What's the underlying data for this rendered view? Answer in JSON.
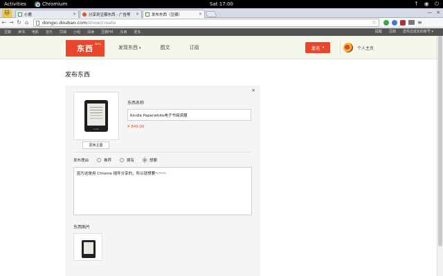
{
  "system": {
    "activities": "Activities",
    "app_name": "Chromium",
    "clock": "Sat 17:00",
    "tray": [
      "↑",
      "◉",
      "⏻"
    ]
  },
  "browser": {
    "profile_icon": "🐱",
    "tabs": [
      {
        "title": "小鹿",
        "favicon": "douban",
        "active": false
      },
      {
        "title": "分享到豆瓣东西 - 广告等",
        "favicon": "share",
        "active": false
      },
      {
        "title": "发布东西（豆瓣）",
        "favicon": "douban",
        "active": true
      }
    ],
    "tab_close": "×",
    "window_controls": [
      "—",
      "×"
    ],
    "nav": {
      "back": "←",
      "forward": "→",
      "reload": "↻",
      "home": "⌂"
    },
    "url_host": "dongxi.douban.com",
    "url_path": "/show/create",
    "star": "☆",
    "menu_icon": "≡"
  },
  "douban_nav": {
    "links": [
      "豆瓣",
      "读书",
      "电影",
      "音乐",
      "同城",
      "小组",
      "阅读",
      "豆瓣FM",
      "东西",
      "更多"
    ],
    "right": [
      "提醒",
      "豆邮",
      "透驾过成长的帐号 ▾"
    ]
  },
  "header": {
    "logo": "东西",
    "logo_beta": "BETA",
    "menu": [
      {
        "label": "发现东西",
        "caret": "▾"
      },
      {
        "label": "图文",
        "caret": ""
      },
      {
        "label": "订阅",
        "caret": ""
      }
    ],
    "publish_label": "发布",
    "publish_caret": "▾",
    "user_label": "个人主页"
  },
  "page": {
    "title": "发布东西",
    "close": "×",
    "product_brand": "kindle",
    "change_image": "更换主图",
    "name_label": "东西名称",
    "name_value": "Kindle Paperwhite电子书阅读器",
    "price": "¥ 849.00",
    "reason_label": "发布理由",
    "reason_options": [
      {
        "label": "推荐",
        "checked": false
      },
      {
        "label": "拥有",
        "checked": false
      },
      {
        "label": "想要",
        "checked": true
      }
    ],
    "reason_text": "因为这是用 Chrome 插件分享的，所以就想要～～～",
    "images_label": "东西图片"
  }
}
